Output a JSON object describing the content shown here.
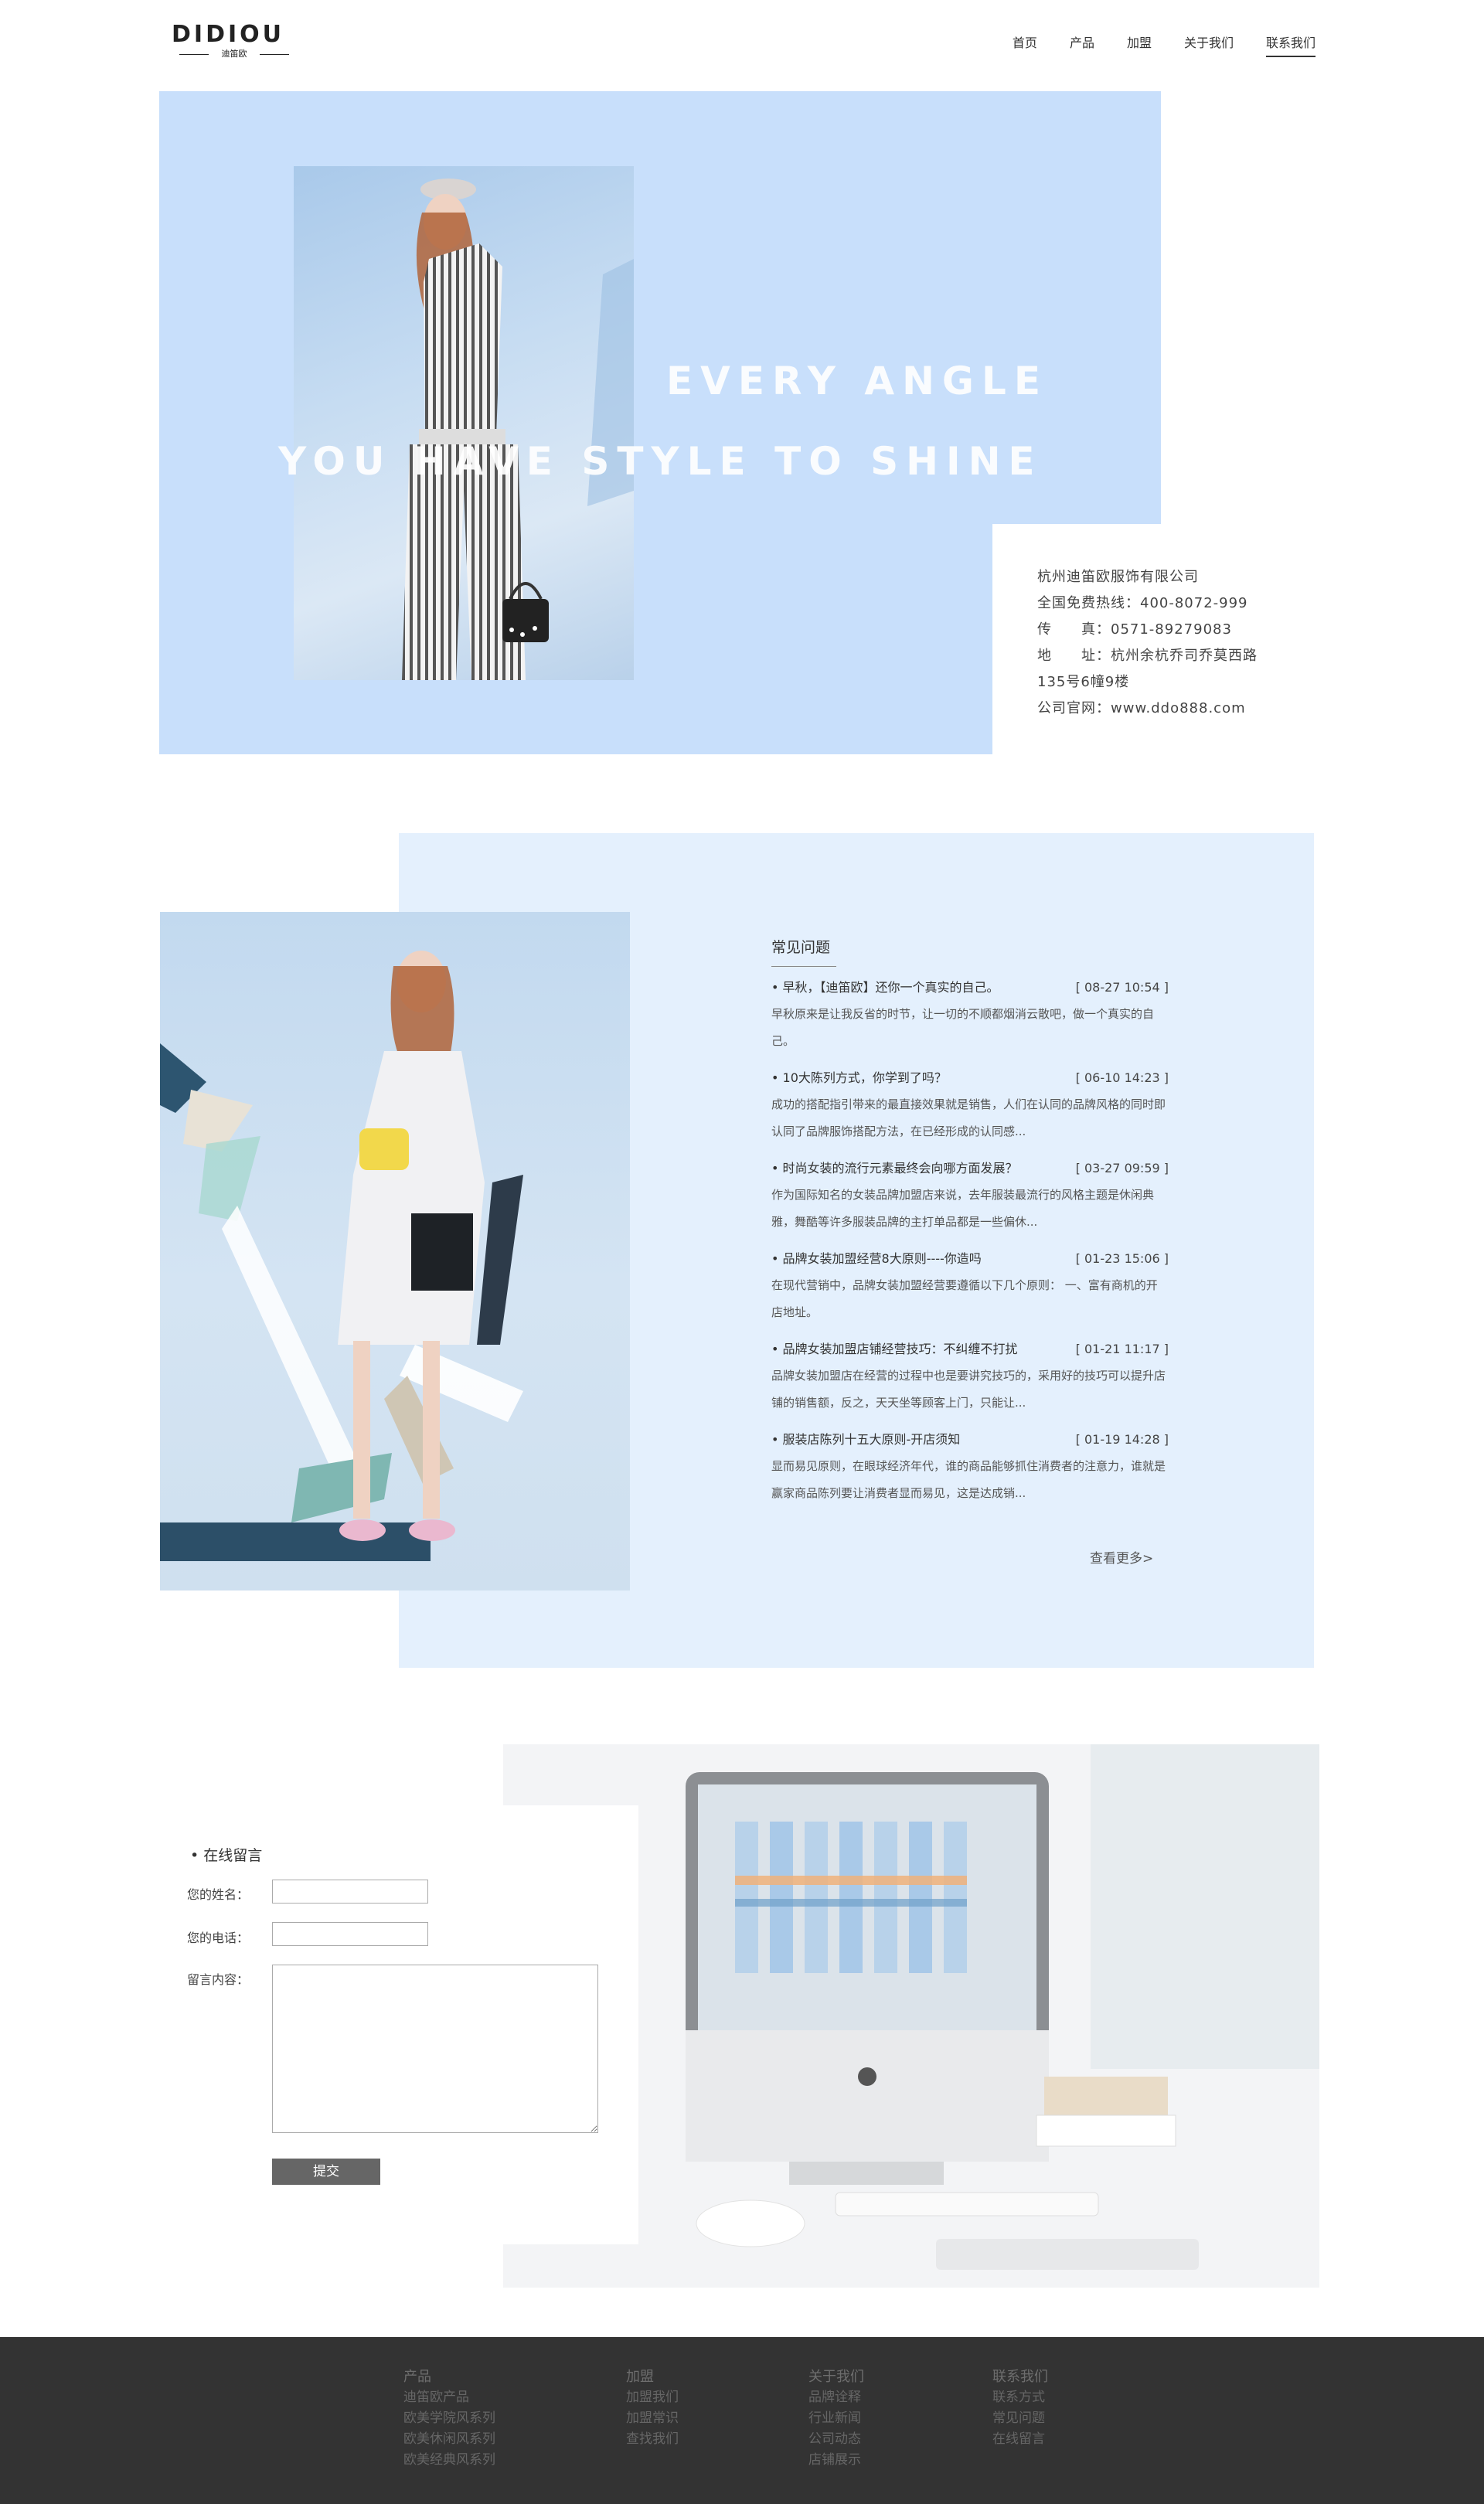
{
  "header": {
    "logo_text": "DIDIOU",
    "logo_sub": "迪笛欧",
    "nav": [
      {
        "label": "首页"
      },
      {
        "label": "产品"
      },
      {
        "label": "加盟"
      },
      {
        "label": "关于我们"
      },
      {
        "label": "联系我们",
        "active": true
      }
    ]
  },
  "hero": {
    "title_line1": "EVERY ANGLE",
    "title_line2": "YOU HAVE STYLE TO SHINE",
    "bg_color": "#c8dffb"
  },
  "contact": {
    "company": "杭州迪笛欧服饰有限公司",
    "hotline": "全国免费热线：400-8072-999",
    "fax": "传　　真：0571-89279083",
    "address1": "地　　址：杭州余杭乔司乔莫西路",
    "address2": "135号6幢9楼",
    "website": "公司官网：www.ddo888.com"
  },
  "faq": {
    "heading": "常见问题",
    "items": [
      {
        "title": "• 早秋，【迪笛欧】还你一个真实的自己。",
        "date": "[ 08-27 10:54 ]",
        "summary": "早秋原来是让我反省的时节，让一切的不顺都烟消云散吧，做一个真实的自己。"
      },
      {
        "title": "• 10大陈列方式，你学到了吗？",
        "date": "[ 06-10 14:23 ]",
        "summary": "成功的搭配指引带来的最直接效果就是销售，人们在认同的品牌风格的同时即认同了品牌服饰搭配方法，在已经形成的认同感..."
      },
      {
        "title": "• 时尚女装的流行元素最终会向哪方面发展？",
        "date": "[ 03-27 09:59 ]",
        "summary": "作为国际知名的女装品牌加盟店来说，去年服装最流行的风格主题是休闲典雅，舞酷等许多服装品牌的主打单品都是一些偏休..."
      },
      {
        "title": "• 品牌女装加盟经营8大原则----你造吗",
        "date": "[ 01-23 15:06 ]",
        "summary": "在现代营销中，品牌女装加盟经营要遵循以下几个原则： 一、富有商机的开店地址。"
      },
      {
        "title": "• 品牌女装加盟店铺经营技巧：不纠缠不打扰",
        "date": "[ 01-21 11:17 ]",
        "summary": "品牌女装加盟店在经营的过程中也是要讲究技巧的，采用好的技巧可以提升店铺的销售额，反之，天天坐等顾客上门，只能让..."
      },
      {
        "title": "• 服装店陈列十五大原则-开店须知",
        "date": "[ 01-19 14:28 ]",
        "summary": "显而易见原则，在眼球经济年代，谁的商品能够抓住消费者的注意力，谁就是赢家商品陈列要让消费者显而易见，这是达成销..."
      }
    ],
    "more_label": "查看更多>"
  },
  "message": {
    "title": "• 在线留言",
    "name_label": "您的姓名：",
    "phone_label": "您的电话：",
    "content_label": "留言内容：",
    "submit_label": "提交"
  },
  "footer": {
    "columns": [
      {
        "heading": "产品",
        "links": [
          "迪笛欧产品",
          "欧美学院风系列",
          "欧美休闲风系列",
          "欧美经典风系列"
        ]
      },
      {
        "heading": "加盟",
        "links": [
          "加盟我们",
          "加盟常识",
          "查找我们"
        ]
      },
      {
        "heading": "关于我们",
        "links": [
          "品牌诠释",
          "行业新闻",
          "公司动态",
          "店铺展示"
        ]
      },
      {
        "heading": "联系我们",
        "links": [
          "联系方式",
          "常见问题",
          "在线留言"
        ]
      }
    ]
  }
}
